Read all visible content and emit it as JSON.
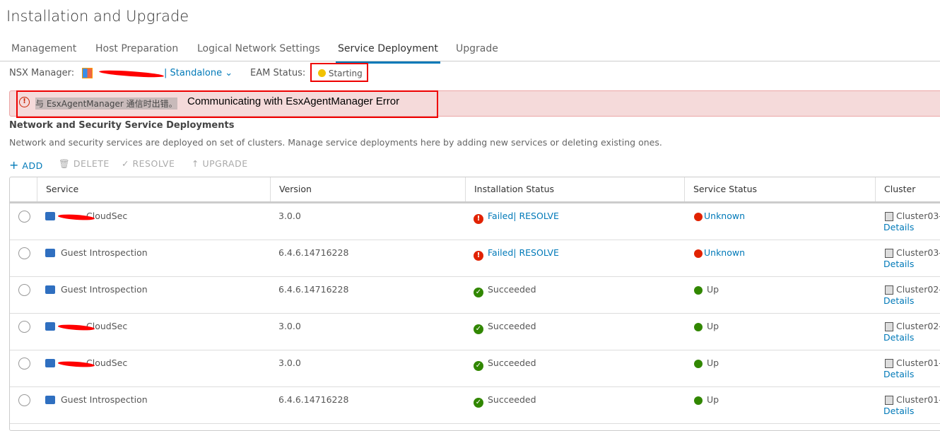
{
  "title": "Installation and Upgrade",
  "tabs": [
    "Management",
    "Host Preparation",
    "Logical Network Settings",
    "Service Deployment",
    "Upgrade"
  ],
  "manager": {
    "label": "NSX Manager:",
    "mode": "Standalone",
    "eam_label": "EAM Status:",
    "eam_status": "Starting",
    "eam_color": "#f2c200"
  },
  "banner": {
    "cn": "与 EsxAgentManager 通信时出错。",
    "en": "Communicating with EsxAgentManager Error"
  },
  "section": {
    "heading": "Network and Security Service Deployments",
    "description": "Network and security services are deployed on set of clusters. Manage service deployments here by adding new services or deleting existing ones."
  },
  "toolbar": {
    "add": "ADD",
    "delete": "DELETE",
    "resolve": "RESOLVE",
    "upgrade": "UPGRADE"
  },
  "columns": [
    "Service",
    "Version",
    "Installation Status",
    "Service Status",
    "Cluster"
  ],
  "rows": [
    {
      "service": "CloudSec",
      "version": "3.0.0",
      "install": "Failed",
      "resolve": "| RESOLVE",
      "status": "Unknown",
      "cluster": "Cluster03-",
      "details": "Details"
    },
    {
      "service": "Guest Introspection",
      "version": "6.4.6.14716228",
      "install": "Failed",
      "resolve": "| RESOLVE",
      "status": "Unknown",
      "cluster": "Cluster03-",
      "details": "Details"
    },
    {
      "service": "Guest Introspection",
      "version": "6.4.6.14716228",
      "install": "Succeeded",
      "status": "Up",
      "cluster": "Cluster02-",
      "details": "Details"
    },
    {
      "service": "CloudSec",
      "version": "3.0.0",
      "install": "Succeeded",
      "status": "Up",
      "cluster": "Cluster02-",
      "details": "Details"
    },
    {
      "service": "CloudSec",
      "version": "3.0.0",
      "install": "Succeeded",
      "status": "Up",
      "cluster": "Cluster01-",
      "details": "Details"
    },
    {
      "service": "Guest Introspection",
      "version": "6.4.6.14716228",
      "install": "Succeeded",
      "status": "Up",
      "cluster": "Cluster01-",
      "details": "Details"
    }
  ]
}
